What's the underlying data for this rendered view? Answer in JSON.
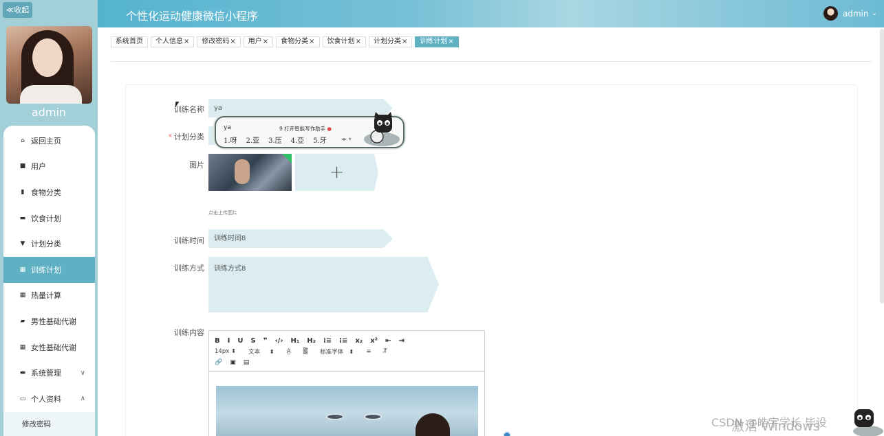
{
  "sidebar": {
    "collapse_label": "≪收起",
    "username": "admin",
    "items": [
      {
        "icon": "home-icon",
        "glyph": "⌂",
        "label": "返回主页"
      },
      {
        "icon": "user-icon",
        "glyph": "■",
        "label": "用户"
      },
      {
        "icon": "bar-chart-icon",
        "glyph": "▮",
        "label": "食物分类"
      },
      {
        "icon": "chat-icon",
        "glyph": "▬",
        "label": "饮食计划"
      },
      {
        "icon": "bookmark-icon",
        "glyph": "▼",
        "label": "计划分类"
      },
      {
        "icon": "grid-icon",
        "glyph": "▦",
        "label": "训练计划"
      },
      {
        "icon": "grid-icon",
        "glyph": "▦",
        "label": "热量计算"
      },
      {
        "icon": "thumbs-up-icon",
        "glyph": "▰",
        "label": "男性基础代谢"
      },
      {
        "icon": "grid-icon",
        "glyph": "▦",
        "label": "女性基础代谢"
      },
      {
        "icon": "monitor-icon",
        "glyph": "▬",
        "label": "系统管理",
        "chevron": "∨"
      },
      {
        "icon": "profile-icon",
        "glyph": "▭",
        "label": "个人资料",
        "chevron": "∧"
      }
    ],
    "active_index": 5,
    "submenu": [
      "修改密码"
    ]
  },
  "header": {
    "title": "个性化运动健康微信小程序",
    "user": "admin",
    "dropdown": "⌄"
  },
  "tabs": [
    {
      "label": "系统首页",
      "closable": false
    },
    {
      "label": "个人信息",
      "closable": true
    },
    {
      "label": "修改密码",
      "closable": true
    },
    {
      "label": "用户",
      "closable": true
    },
    {
      "label": "食物分类",
      "closable": true
    },
    {
      "label": "饮食计划",
      "closable": true
    },
    {
      "label": "计划分类",
      "closable": true
    },
    {
      "label": "训练计划",
      "closable": true,
      "active": true
    }
  ],
  "form": {
    "name_label": "训练名称",
    "name_value": "ya",
    "category_label": "计划分类",
    "image_label": "图片",
    "upload_hint": "点击上传图片",
    "upload_plus": "+",
    "time_label": "训练时间",
    "time_value": "训练时间8",
    "method_label": "训练方式",
    "method_value": "训练方式8",
    "content_label": "训练内容"
  },
  "editor": {
    "row1": [
      "B",
      "I",
      "U",
      "S",
      "❞",
      "‹/›",
      "H₁",
      "H₂",
      "⁞≡",
      "⁝≡",
      "x₂",
      "x²",
      "⇤",
      "⇥"
    ],
    "font_size": "14px",
    "text_type": "文本",
    "font_family": "标准字体",
    "row3": [
      "🔗",
      "▣",
      "▤"
    ]
  },
  "ime": {
    "input": "ya",
    "assist": "9 打开智能写作助手",
    "candidates": [
      "1.呀",
      "2.亚",
      "3.压",
      "4.亞",
      "5.牙"
    ]
  },
  "watermark": {
    "activate": "激活 Windows",
    "csdn": "CSDN @皓宇学长 毕设"
  }
}
